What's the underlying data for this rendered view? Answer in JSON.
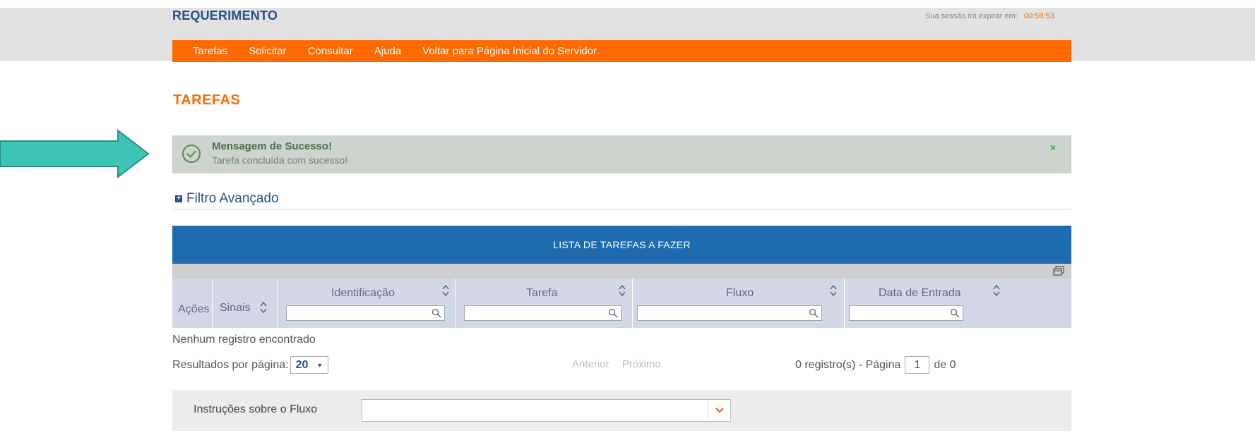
{
  "app": {
    "title": "REQUERIMENTO",
    "session_label": "Sua sessão irá expirar em:",
    "session_timer": "00:59:53"
  },
  "menu": {
    "items": [
      {
        "label": "Tarefas"
      },
      {
        "label": "Solicitar"
      },
      {
        "label": "Consultar"
      },
      {
        "label": "Ajuda"
      },
      {
        "label": "Voltar para Página Inicial do Servidor"
      }
    ]
  },
  "page": {
    "title": "TAREFAS"
  },
  "success": {
    "title": "Mensagem de Sucesso!",
    "text": "Tarefa concluída com sucesso!",
    "close_label": "×",
    "icon": "check-circle-icon"
  },
  "filter": {
    "label": "Filtro Avançado"
  },
  "table": {
    "header": "LISTA DE TAREFAS A FAZER",
    "columns": [
      {
        "label": "Ações"
      },
      {
        "label": "Sinais"
      },
      {
        "label": "Identificação"
      },
      {
        "label": "Tarefa"
      },
      {
        "label": "Fluxo"
      },
      {
        "label": "Data de Entrada"
      }
    ],
    "empty_message": "Nenhum registro encontrado"
  },
  "pager": {
    "per_page_label": "Resultados por página:",
    "per_page_value": "20",
    "prev": "Anterior",
    "next": "Próximo",
    "records_label": "0 registro(s) - Página",
    "page_value": "1",
    "of_label": "de 0"
  },
  "instructions": {
    "label": "Instruções sobre o Fluxo",
    "value": ""
  },
  "colors": {
    "brand_blue": "#24528a",
    "menu_orange": "#ff6a00",
    "table_header_blue": "#1f6bb0",
    "success_bg": "#cdd4cd",
    "annotation_arrow": "#3dc4b4"
  }
}
